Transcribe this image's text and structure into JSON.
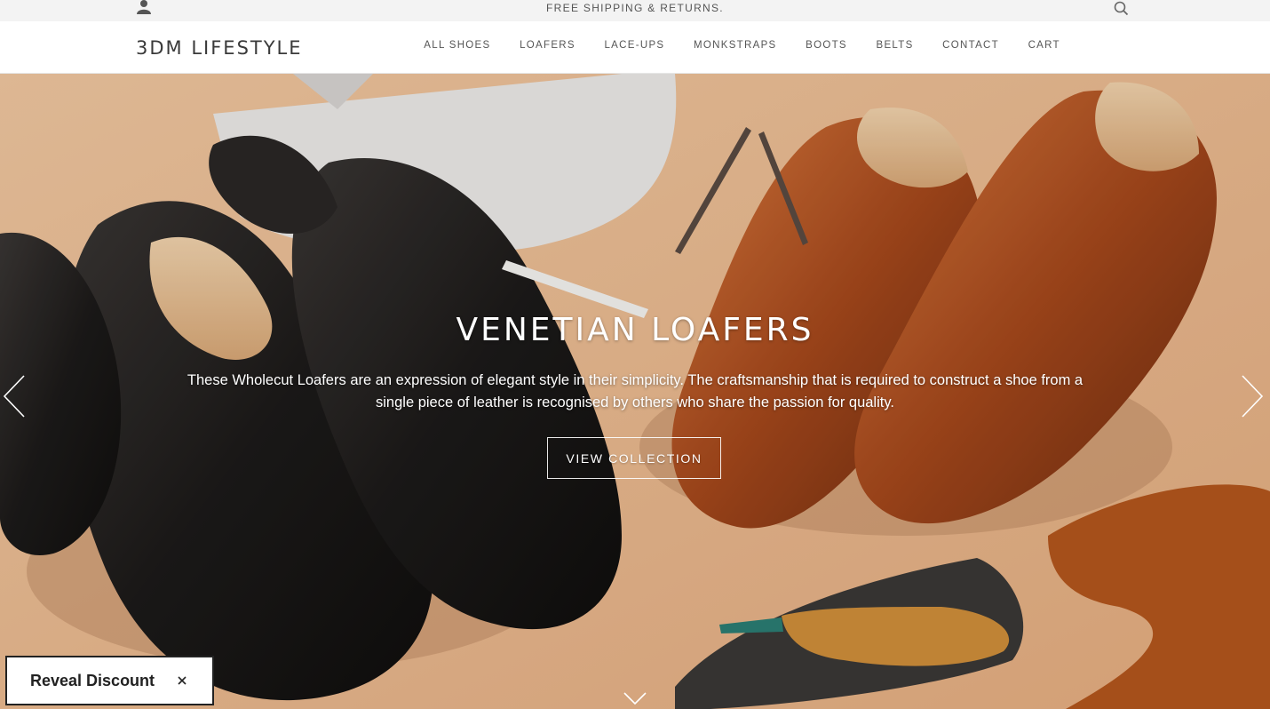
{
  "announcement": {
    "text": "FREE SHIPPING & RETURNS."
  },
  "icons": {
    "account": "user-icon",
    "search": "search-icon",
    "prev": "chevron-left-icon",
    "next": "chevron-right-icon",
    "scroll": "chevron-down-icon",
    "close": "close-icon"
  },
  "header": {
    "logo": "3DM LIFESTYLE",
    "nav": [
      "ALL SHOES",
      "LOAFERS",
      "LACE-UPS",
      "MONKSTRAPS",
      "BOOTS",
      "BELTS",
      "CONTACT",
      "CART"
    ]
  },
  "hero": {
    "title": "VENETIAN LOAFERS",
    "description": "These Wholecut Loafers are an expression of elegant style in their simplicity. The craftsmanship that is required to construct a shoe from a single piece of leather is recognised by others who share the passion for quality.",
    "button": "VIEW COLLECTION"
  },
  "popup": {
    "label": "Reveal Discount"
  },
  "colors": {
    "accent": "#222222",
    "hero_bg": "#e8b98f",
    "black_shoe": "#1c1a19",
    "brown_shoe": "#a5481c"
  }
}
